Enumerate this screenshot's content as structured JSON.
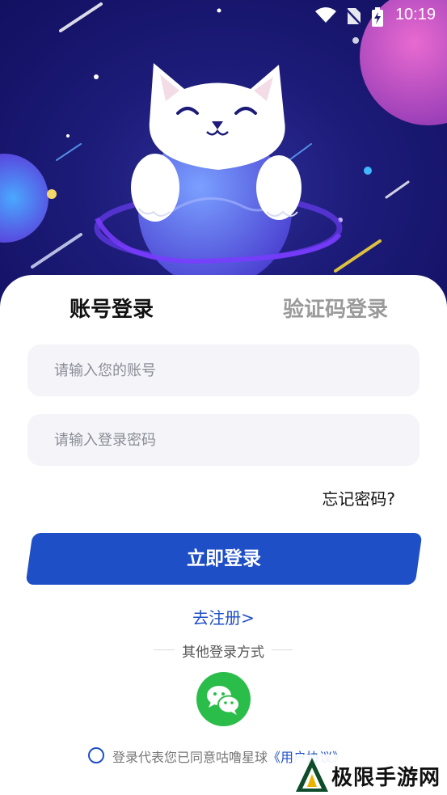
{
  "status_bar": {
    "time": "10:19",
    "icons": [
      "wifi-icon",
      "no-sim-icon",
      "battery-charging-icon"
    ]
  },
  "tabs": {
    "account": "账号登录",
    "code": "验证码登录"
  },
  "fields": {
    "account_placeholder": "请输入您的账号",
    "password_placeholder": "请输入登录密码"
  },
  "forgot_password": "忘记密码?",
  "login_button": "立即登录",
  "register_link": "去注册>",
  "other_login": "其他登录方式",
  "other_login_methods": [
    "wechat-icon"
  ],
  "agreement": {
    "text": "登录代表您已同意咕噜星球",
    "link": "《用户协议》"
  },
  "watermark": {
    "text": "极限手游网"
  },
  "colors": {
    "accent": "#1f4fc7",
    "hero": "#1c1b78",
    "wechat": "#2bbd4a",
    "field_bg": "#f4f4f9"
  }
}
